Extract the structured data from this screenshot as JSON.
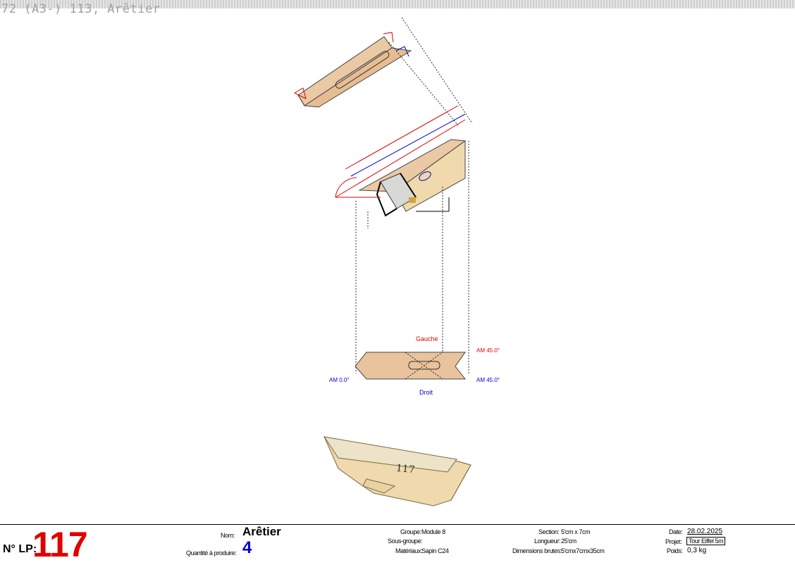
{
  "header": {
    "title": "72 (A3-)  113, Arêtier"
  },
  "drawing": {
    "labels": {
      "gauche": "Gauche",
      "droit": "Droit",
      "am_top_right": "AM 45.0°",
      "am_bottom_right": "AM 45.0°",
      "am_left": "AM 0.0°",
      "part_number": "117"
    },
    "colors": {
      "wood": "#e8c39c",
      "wood_light": "#f2e0b6",
      "red": "#e00000",
      "blue": "#0000cc"
    }
  },
  "footer": {
    "lp_label": "N° LP:",
    "lp_number": "117",
    "nom_label": "Nom:",
    "nom_value": "Arêtier",
    "qty_label": "Quantité à produire:",
    "qty_value": "4",
    "groupe_label": "Groupe:",
    "groupe_value": "Module 8",
    "sousgroupe_label": "Sous-groupe:",
    "sousgroupe_value": "",
    "materiaux_label": "Matériaux:",
    "materiaux_value": "Sapin C24",
    "section_label": "Section:",
    "section_value": "5'cm x 7cm",
    "longueur_label": "Longueur:",
    "longueur_value": "25'cm",
    "dims_label": "Dimensions brutes:",
    "dims_value": "5'cmx7cmx35cm",
    "date_label": "Date:",
    "date_value": "28.02.2025",
    "projet_label": "Projet:",
    "projet_value": "Tour Eiffel 5m",
    "poids_label": "Poids:",
    "poids_value": "0,3 kg"
  }
}
